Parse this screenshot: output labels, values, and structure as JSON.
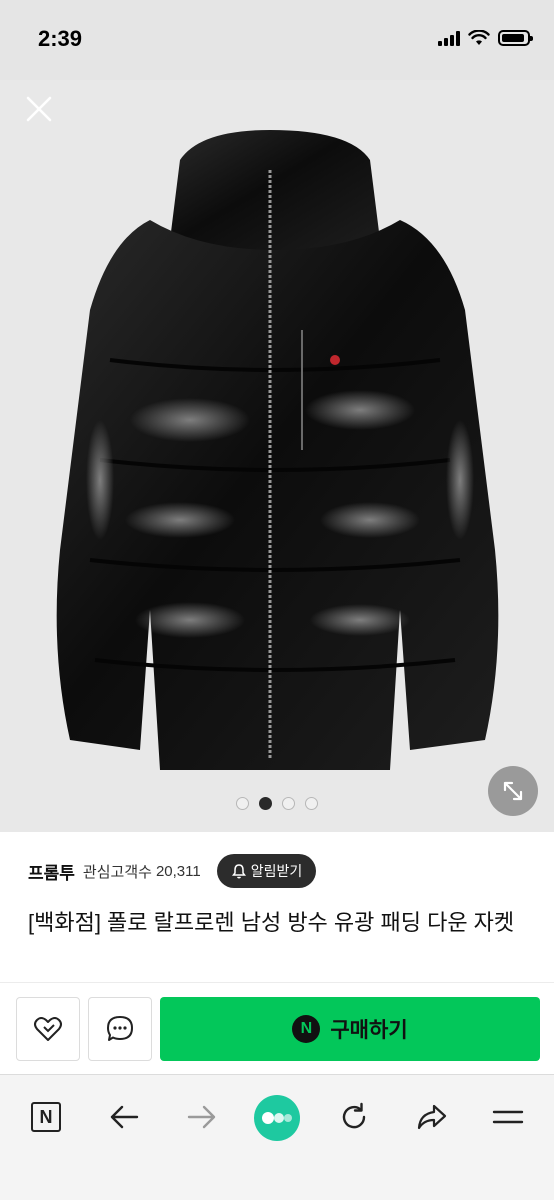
{
  "status": {
    "time": "2:39"
  },
  "gallery": {
    "current_index": 2,
    "total": 4
  },
  "store": {
    "name": "프롬투",
    "followers_label": "관심고객수",
    "followers_count": "20,311",
    "alarm_label": "알림받기"
  },
  "product": {
    "title": "[백화점] 폴로 랄프로렌 남성 방수 유광 패딩 다운 자켓"
  },
  "actions": {
    "buy_label": "구매하기",
    "npay_letter": "N"
  },
  "browser": {
    "home_letter": "N"
  },
  "colors": {
    "buy_green": "#03c75a",
    "alarm_dark": "#2c2c2c",
    "browser_center": "#1ec9a0"
  }
}
